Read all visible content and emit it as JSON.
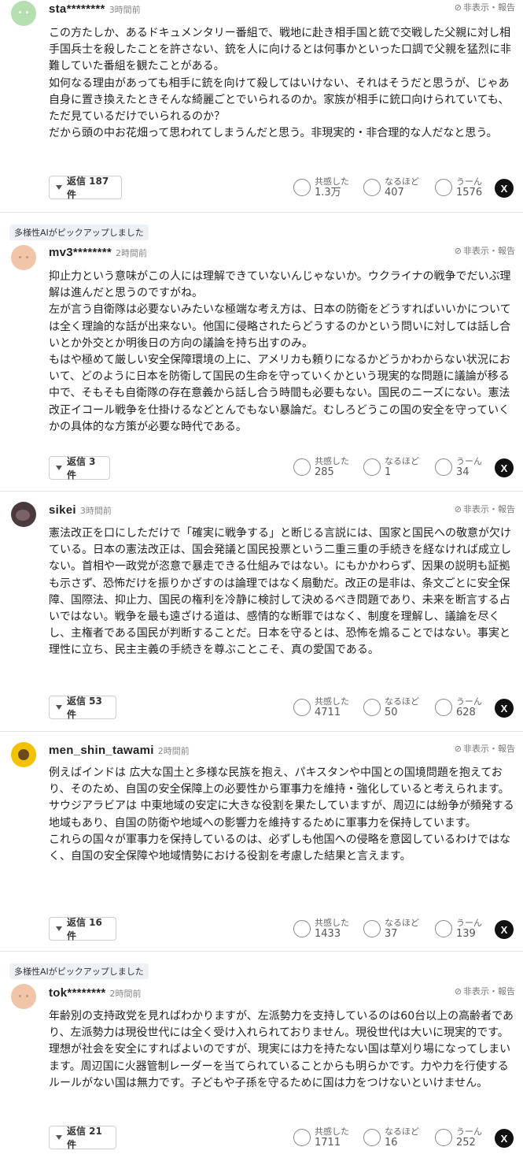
{
  "comments": [
    {
      "user": "sta********",
      "time": "3時間前",
      "hide_label": "非表示・報告",
      "body": "この方たしか、あるドキュメンタリー番組で、戦地に赴き相手国と銃で交戦した父親に対し相手国兵士を殺したことを許さない、銃を人に向けるとは何事かといった口調で父親を猛烈に非難していた番組を観たことがある。\n如何なる理由があっても相手に銃を向けて殺してはいけない、それはそうだと思うが、じゃあ自身に置き換えたときそんな綺麗ごとでいられるのか。家族が相手に銃口向けられていても、ただ見ているだけでいられるのか？\nだから頭の中お花畑って思われてしまうんだと思う。非現実的・非合理的な人だなと思う。",
      "reply_label": "返信 187件",
      "reactions": [
        {
          "label": "共感した",
          "count": "1.3万"
        },
        {
          "label": "なるほど",
          "count": "407"
        },
        {
          "label": "うーん",
          "count": "1576"
        }
      ]
    },
    {
      "badge": "多様性AIがピックアップしました",
      "user": "mv3********",
      "time": "2時間前",
      "hide_label": "非表示・報告",
      "body": "抑止力という意味がこの人には理解できていないんじゃないか。ウクライナの戦争でだいぶ理解は進んだと思うのですがね。\n左が言う自衛隊は必要ないみたいな極端な考え方は、日本の防衛をどうすればいいかについては全く理論的な話が出来ない。他国に侵略されたらどうするのかという問いに対しては話し合いとか外交とか明後日の方向の議論を持ち出すのみ。\nもはや極めて厳しい安全保障環境の上に、アメリカも頼りになるかどうかわからない状況において、どのように日本を防衛して国民の生命を守っていくかという現実的な問題に議論が移る中で、そもそも自衛隊の存在意義から話し合う時間も必要もない。国民のニーズにない。憲法改正イコール戦争を仕掛けるなどとんでもない暴論だ。むしろどうこの国の安全を守っていくかの具体的な方策が必要な時代である。",
      "reply_label": "返信 3件",
      "reactions": [
        {
          "label": "共感した",
          "count": "285"
        },
        {
          "label": "なるほど",
          "count": "1"
        },
        {
          "label": "うーん",
          "count": "34"
        }
      ]
    },
    {
      "user": "sikei",
      "time": "3時間前",
      "hide_label": "非表示・報告",
      "body": "憲法改正を口にしただけで「確実に戦争する」と断じる言説には、国家と国民への敬意が欠けている。日本の憲法改正は、国会発議と国民投票という二重三重の手続きを経なければ成立しない。首相や一政党が恣意で暴走できる仕組みではない。にもかかわらず、因果の説明も証拠も示さず、恐怖だけを振りかざすのは論理ではなく扇動だ。改正の是非は、条文ごとに安全保障、国際法、抑止力、国民の権利を冷静に検討して決めるべき問題であり、未来を断言する占いではない。戦争を最も遠ざける道は、感情的な断罪ではなく、制度を理解し、議論を尽くし、主権者である国民が判断することだ。日本を守るとは、恐怖を煽ることではない。事実と理性に立ち、民主主義の手続きを尊ぶことこそ、真の愛国である。",
      "reply_label": "返信 53件",
      "reactions": [
        {
          "label": "共感した",
          "count": "4711"
        },
        {
          "label": "なるほど",
          "count": "50"
        },
        {
          "label": "うーん",
          "count": "628"
        }
      ]
    },
    {
      "user": "men_shin_tawami",
      "time": "2時間前",
      "hide_label": "非表示・報告",
      "body": "例えばインドは 広大な国土と多様な民族を抱え、パキスタンや中国との国境問題を抱えており、そのため、自国の安全保障上の必要性から軍事力を維持・強化していると考えられます。\nサウジアラビアは 中東地域の安定に大きな役割を果たしていますが、周辺には紛争が頻発する地域もあり、自国の防衛や地域への影響力を維持するために軍事力を保持しています。\nこれらの国々が軍事力を保持しているのは、必ずしも他国への侵略を意図しているわけではなく、自国の安全保障や地域情勢における役割を考慮した結果と言えます。",
      "reply_label": "返信 16件",
      "reactions": [
        {
          "label": "共感した",
          "count": "1433"
        },
        {
          "label": "なるほど",
          "count": "37"
        },
        {
          "label": "うーん",
          "count": "139"
        }
      ]
    },
    {
      "badge": "多様性AIがピックアップしました",
      "user": "tok********",
      "time": "2時間前",
      "hide_label": "非表示・報告",
      "body": "年齢別の支持政党を見ればわかりますが、左派勢力を支持しているのは60台以上の高齢者であり、左派勢力は現役世代には全く受け入れられておりません。現役世代は大いに現実的です。理想が社会を安全にすればよいのですが、現実には力を持たない国は草刈り場になってしまいます。周辺国に火器管制レーダーを当てられていることからも明らかです。力や力を行使するルールがない国は無力です。子どもや子孫を守るために国は力をつけないといけません。",
      "reply_label": "返信 21件",
      "reactions": [
        {
          "label": "共感した",
          "count": "1711"
        },
        {
          "label": "なるほど",
          "count": "16"
        },
        {
          "label": "うーん",
          "count": "252"
        }
      ]
    }
  ],
  "share_label": "X",
  "colors": {
    "avatar1": "#b5dfb0",
    "avatar2": "#f1c6a8",
    "avatar3": "#4a3a3d",
    "avatar4": "#f2c200",
    "avatar5": "#f1c6a8"
  }
}
